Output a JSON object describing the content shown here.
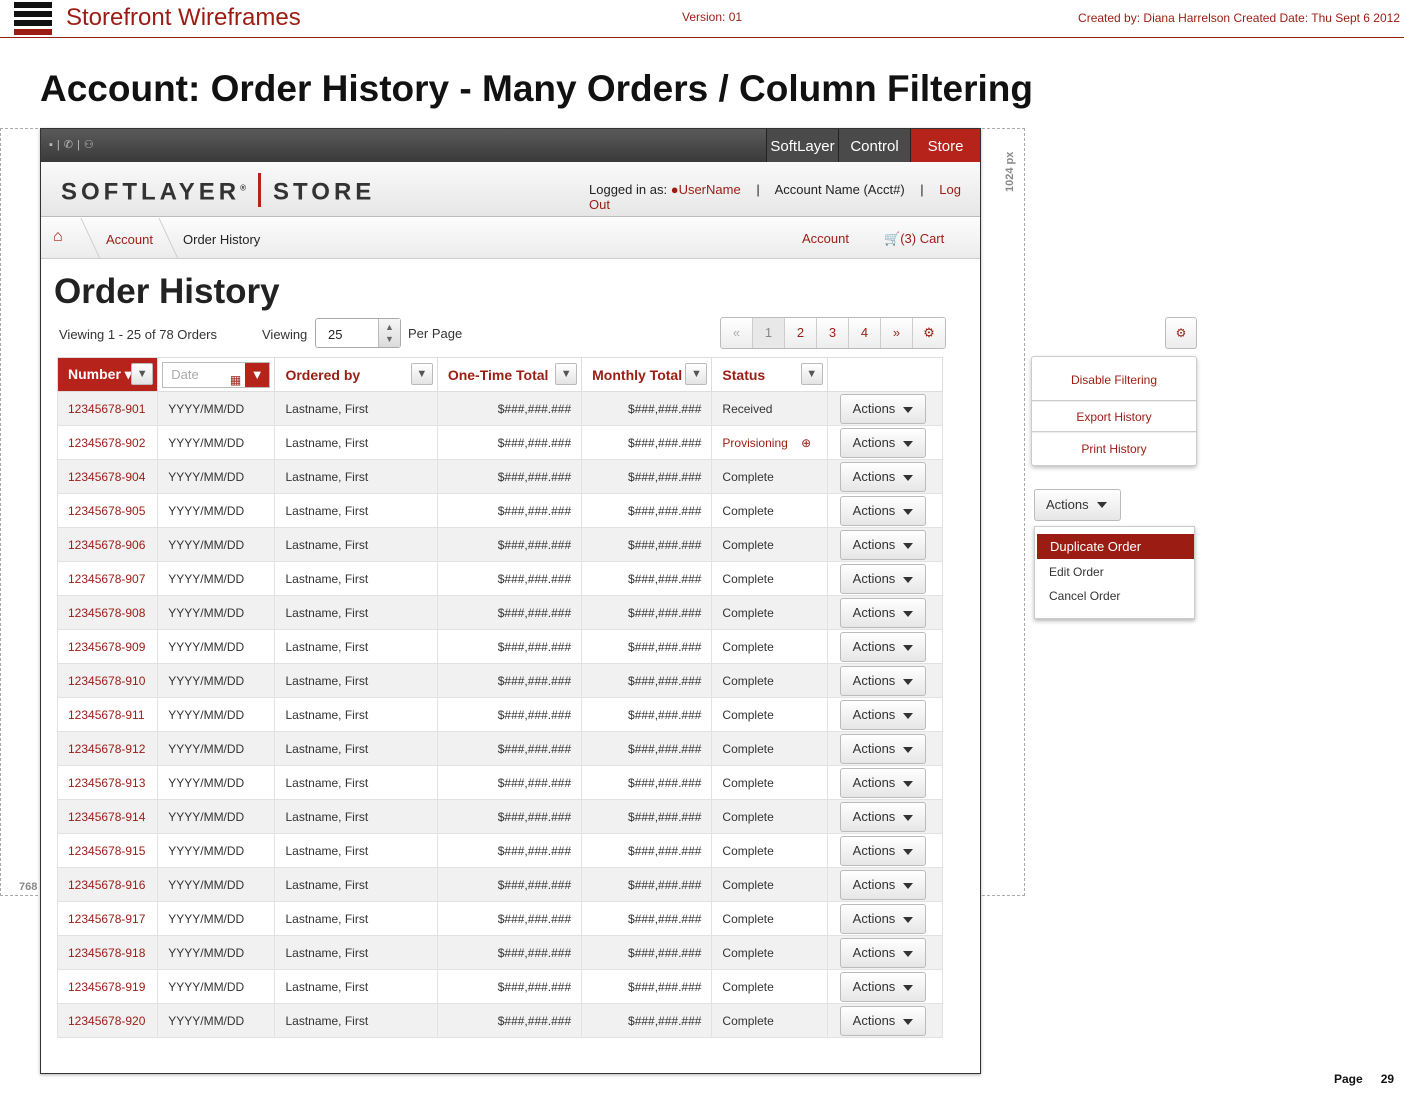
{
  "wireframe": {
    "title": "Storefront Wireframes",
    "version": "Version: 01",
    "created": "Created by: Diana Harrelson  Created Date: Thu Sept 6 2012",
    "heading": "Account: Order History - Many Orders / Column Filtering",
    "dim_width": "1024 px",
    "dim_height": "768",
    "page_label": "Page",
    "page_number": "29"
  },
  "topbar": {
    "tabs": [
      "SoftLayer",
      "Control",
      "Store"
    ]
  },
  "brand": {
    "logo_left": "SOFTLAYER",
    "logo_reg": "®",
    "logo_right": "STORE",
    "logged_in_label": "Logged in as:",
    "username": "UserName",
    "account": "Account Name (Acct#)",
    "logout": "Log Out"
  },
  "breadcrumb": {
    "account": "Account",
    "current": "Order History",
    "right_account": "Account",
    "cart": "(3) Cart"
  },
  "main": {
    "title": "Order History",
    "viewing_count": "Viewing 1 - 25 of 78 Orders",
    "viewing_label": "Viewing",
    "per_page_value": "25",
    "per_page_label": "Per Page",
    "pager": [
      "«",
      "1",
      "2",
      "3",
      "4",
      "»",
      "⚙"
    ]
  },
  "table": {
    "headers": {
      "number": "Number ▾",
      "date_placeholder": "Date",
      "ordered_by": "Ordered by",
      "one_time": "One-Time Total",
      "monthly": "Monthly Total",
      "status": "Status"
    },
    "action_label": "Actions",
    "rows": [
      {
        "id": "12345678-901",
        "date": "YYYY/MM/DD",
        "by": "Lastname, First",
        "one": "$###,###.###",
        "mon": "$###,###.###",
        "status": "Received"
      },
      {
        "id": "12345678-902",
        "date": "YYYY/MM/DD",
        "by": "Lastname, First",
        "one": "$###,###.###",
        "mon": "$###,###.###",
        "status": "Provisioning"
      },
      {
        "id": "12345678-904",
        "date": "YYYY/MM/DD",
        "by": "Lastname, First",
        "one": "$###,###.###",
        "mon": "$###,###.###",
        "status": "Complete"
      },
      {
        "id": "12345678-905",
        "date": "YYYY/MM/DD",
        "by": "Lastname, First",
        "one": "$###,###.###",
        "mon": "$###,###.###",
        "status": "Complete"
      },
      {
        "id": "12345678-906",
        "date": "YYYY/MM/DD",
        "by": "Lastname, First",
        "one": "$###,###.###",
        "mon": "$###,###.###",
        "status": "Complete"
      },
      {
        "id": "12345678-907",
        "date": "YYYY/MM/DD",
        "by": "Lastname, First",
        "one": "$###,###.###",
        "mon": "$###,###.###",
        "status": "Complete"
      },
      {
        "id": "12345678-908",
        "date": "YYYY/MM/DD",
        "by": "Lastname, First",
        "one": "$###,###.###",
        "mon": "$###,###.###",
        "status": "Complete"
      },
      {
        "id": "12345678-909",
        "date": "YYYY/MM/DD",
        "by": "Lastname, First",
        "one": "$###,###.###",
        "mon": "$###,###.###",
        "status": "Complete"
      },
      {
        "id": "12345678-910",
        "date": "YYYY/MM/DD",
        "by": "Lastname, First",
        "one": "$###,###.###",
        "mon": "$###,###.###",
        "status": "Complete"
      },
      {
        "id": "12345678-911",
        "date": "YYYY/MM/DD",
        "by": "Lastname, First",
        "one": "$###,###.###",
        "mon": "$###,###.###",
        "status": "Complete"
      },
      {
        "id": "12345678-912",
        "date": "YYYY/MM/DD",
        "by": "Lastname, First",
        "one": "$###,###.###",
        "mon": "$###,###.###",
        "status": "Complete"
      },
      {
        "id": "12345678-913",
        "date": "YYYY/MM/DD",
        "by": "Lastname, First",
        "one": "$###,###.###",
        "mon": "$###,###.###",
        "status": "Complete"
      },
      {
        "id": "12345678-914",
        "date": "YYYY/MM/DD",
        "by": "Lastname, First",
        "one": "$###,###.###",
        "mon": "$###,###.###",
        "status": "Complete"
      },
      {
        "id": "12345678-915",
        "date": "YYYY/MM/DD",
        "by": "Lastname, First",
        "one": "$###,###.###",
        "mon": "$###,###.###",
        "status": "Complete"
      },
      {
        "id": "12345678-916",
        "date": "YYYY/MM/DD",
        "by": "Lastname, First",
        "one": "$###,###.###",
        "mon": "$###,###.###",
        "status": "Complete"
      },
      {
        "id": "12345678-917",
        "date": "YYYY/MM/DD",
        "by": "Lastname, First",
        "one": "$###,###.###",
        "mon": "$###,###.###",
        "status": "Complete"
      },
      {
        "id": "12345678-918",
        "date": "YYYY/MM/DD",
        "by": "Lastname, First",
        "one": "$###,###.###",
        "mon": "$###,###.###",
        "status": "Complete"
      },
      {
        "id": "12345678-919",
        "date": "YYYY/MM/DD",
        "by": "Lastname, First",
        "one": "$###,###.###",
        "mon": "$###,###.###",
        "status": "Complete"
      },
      {
        "id": "12345678-920",
        "date": "YYYY/MM/DD",
        "by": "Lastname, First",
        "one": "$###,###.###",
        "mon": "$###,###.###",
        "status": "Complete"
      }
    ]
  },
  "side": {
    "settings_menu": [
      "Disable Filtering",
      "Export History",
      "Print History"
    ],
    "actions_label": "Actions",
    "actions_menu": [
      "Duplicate Order",
      "Edit Order",
      "Cancel Order"
    ]
  },
  "icons": {
    "home": "home-icon",
    "cart": "cart-icon",
    "user": "user-icon",
    "filter": "filter-icon",
    "calendar": "calendar-icon",
    "gear": "gear-icon",
    "zoom": "magnify-icon"
  },
  "colors": {
    "brand_red": "#9b1c13",
    "store_tab": "#b6231a"
  }
}
